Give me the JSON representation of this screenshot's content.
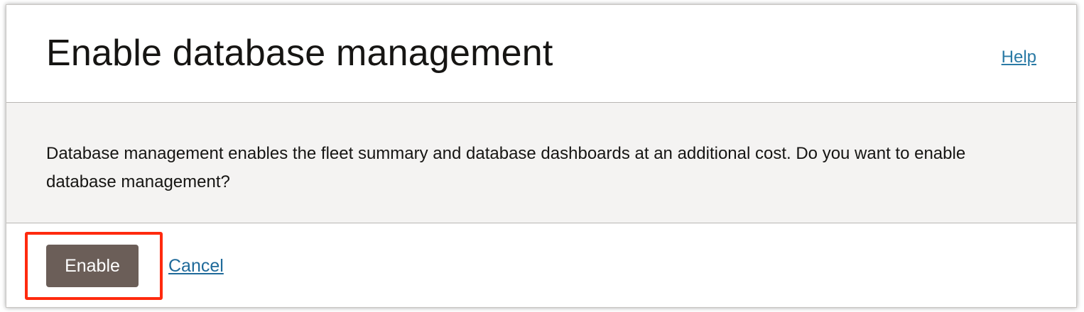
{
  "dialog": {
    "title": "Enable database management",
    "help_label": "Help",
    "message": "Database management enables the fleet summary and database dashboards at an additional cost. Do you want to enable database management?",
    "enable_label": "Enable",
    "cancel_label": "Cancel"
  },
  "colors": {
    "primary_button": "#6b5e58",
    "link": "#1f6a9a",
    "highlight": "#ff2a0e",
    "body_background": "#f4f3f2"
  }
}
